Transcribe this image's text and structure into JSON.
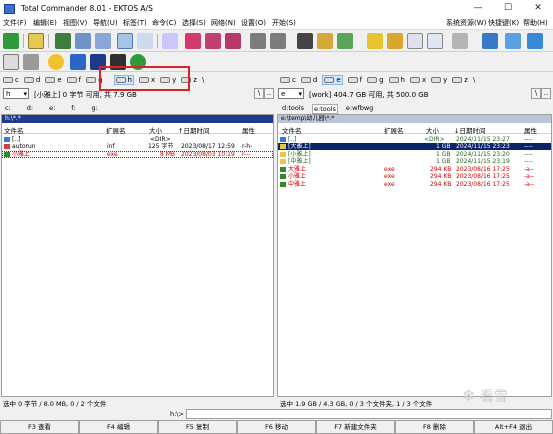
{
  "window": {
    "title": "Total Commander 8.01 - EKTOS A/S",
    "min": "—",
    "max": "☐",
    "close": "✕"
  },
  "menu": {
    "items": [
      "文件(F)",
      "编辑(E)",
      "视图(V)",
      "导航(U)",
      "标签(T)",
      "命令(C)",
      "选择(S)",
      "网络(N)",
      "设置(O)",
      "开始(S)"
    ],
    "right": [
      "系统资源(W)",
      "快捷键(K)",
      "帮助(H)"
    ]
  },
  "drivebar": {
    "left": [
      "c",
      "d",
      "e",
      "f",
      "g",
      "h",
      "x",
      "y",
      "z"
    ],
    "right": [
      "c",
      "d",
      "e",
      "f",
      "g",
      "h",
      "x",
      "y",
      "z"
    ],
    "left_selected": "h",
    "right_selected": "e",
    "root": "\\"
  },
  "left_panel": {
    "drive": "h",
    "free": "[小雅上]  0 字节 可用, 共 7.9 GB",
    "tabs": [
      "c:",
      "d:",
      "e:",
      "f:",
      "g:"
    ],
    "path": "h:\\*.*",
    "columns": [
      "文件名",
      "扩展名",
      "大小",
      "↑日期时间",
      "属性"
    ],
    "files": [
      {
        "name": "[..]",
        "ext": "",
        "size": "<DIR>",
        "date": "",
        "attr": ""
      },
      {
        "name": "autorun",
        "ext": "inf",
        "size": "125 字节",
        "date": "2023/08/17 12:59",
        "attr": "r-h-"
      },
      {
        "name": "小雅上",
        "ext": "exe",
        "size": "8 MB",
        "date": "2023/08/03 10:19",
        "attr": "r---"
      }
    ],
    "status": "选中 0 字节 / 8.0 MB, 0 / 2 个文件"
  },
  "right_panel": {
    "drive": "e",
    "free": "[work]  404.7 GB 可用, 共 500.0 GB",
    "tabs": [
      "d:tools",
      "e:tools",
      "e:wfbwg"
    ],
    "path": "e:\\temp\\幼儿园\\*.*",
    "columns": [
      "文件名",
      "扩展名",
      "大小",
      "↓日期时间",
      "属性"
    ],
    "files": [
      {
        "name": "[..]",
        "ext": "",
        "size": "<DIR>",
        "date": "2024/11/15 23:27",
        "attr": "----"
      },
      {
        "name": "[大雅上]",
        "ext": "",
        "size": "1 GB",
        "date": "2024/11/15 23:23",
        "attr": "----"
      },
      {
        "name": "[小雅上]",
        "ext": "",
        "size": "1 GB",
        "date": "2024/11/15 23:20",
        "attr": "----"
      },
      {
        "name": "[中雅上]",
        "ext": "",
        "size": "1 GB",
        "date": "2024/11/15 23:19",
        "attr": "----"
      },
      {
        "name": "大雅上",
        "ext": "exe",
        "size": "294 KB",
        "date": "2023/08/16 17:25",
        "attr": "-a--"
      },
      {
        "name": "小雅上",
        "ext": "exe",
        "size": "294 KB",
        "date": "2023/08/16 17:25",
        "attr": "-a--"
      },
      {
        "name": "中雅上",
        "ext": "exe",
        "size": "294 KB",
        "date": "2023/08/16 17:25",
        "attr": "-a--"
      }
    ],
    "status": "选中 1.9 GB / 4.3 GB, 0 / 3 个文件夹, 1 / 3 个文件"
  },
  "cmdline": {
    "prompt": "h:\\>"
  },
  "fkeys": [
    "F3 查看",
    "F4 编辑",
    "F5 复制",
    "F6 移动",
    "F7 新建文件夹",
    "F8 删除",
    "Alt+F4 退出"
  ],
  "watermark": {
    "glyph": "❄",
    "text": "看雪"
  },
  "colors": {
    "active_path": "#1f3a8a",
    "selected_row": "#0a246a",
    "exe_text": "#cc0000",
    "dir_text": "#1f6a1f",
    "annotation": "#d8232a"
  },
  "icons": {
    "toolbar": [
      "refresh-icon",
      "tree-icon",
      "thumbnail-icon",
      "brief-view-icon",
      "full-view-icon",
      "search-icon",
      "sort-icon",
      "select-icon",
      "deselect-icon",
      "back-icon",
      "forward-icon",
      "binoculars-icon",
      "copy-icon",
      "move-icon",
      "pack-icon",
      "unpack-icon",
      "ftp-icon",
      "url-icon",
      "sync-icon",
      "tools-icon",
      "network-icon",
      "monitor-icon"
    ],
    "toolbar2": [
      "notepad-icon",
      "calculator-icon",
      "star-icon",
      "letter-e-icon",
      "save-icon",
      "book-icon",
      "reload-icon"
    ]
  }
}
